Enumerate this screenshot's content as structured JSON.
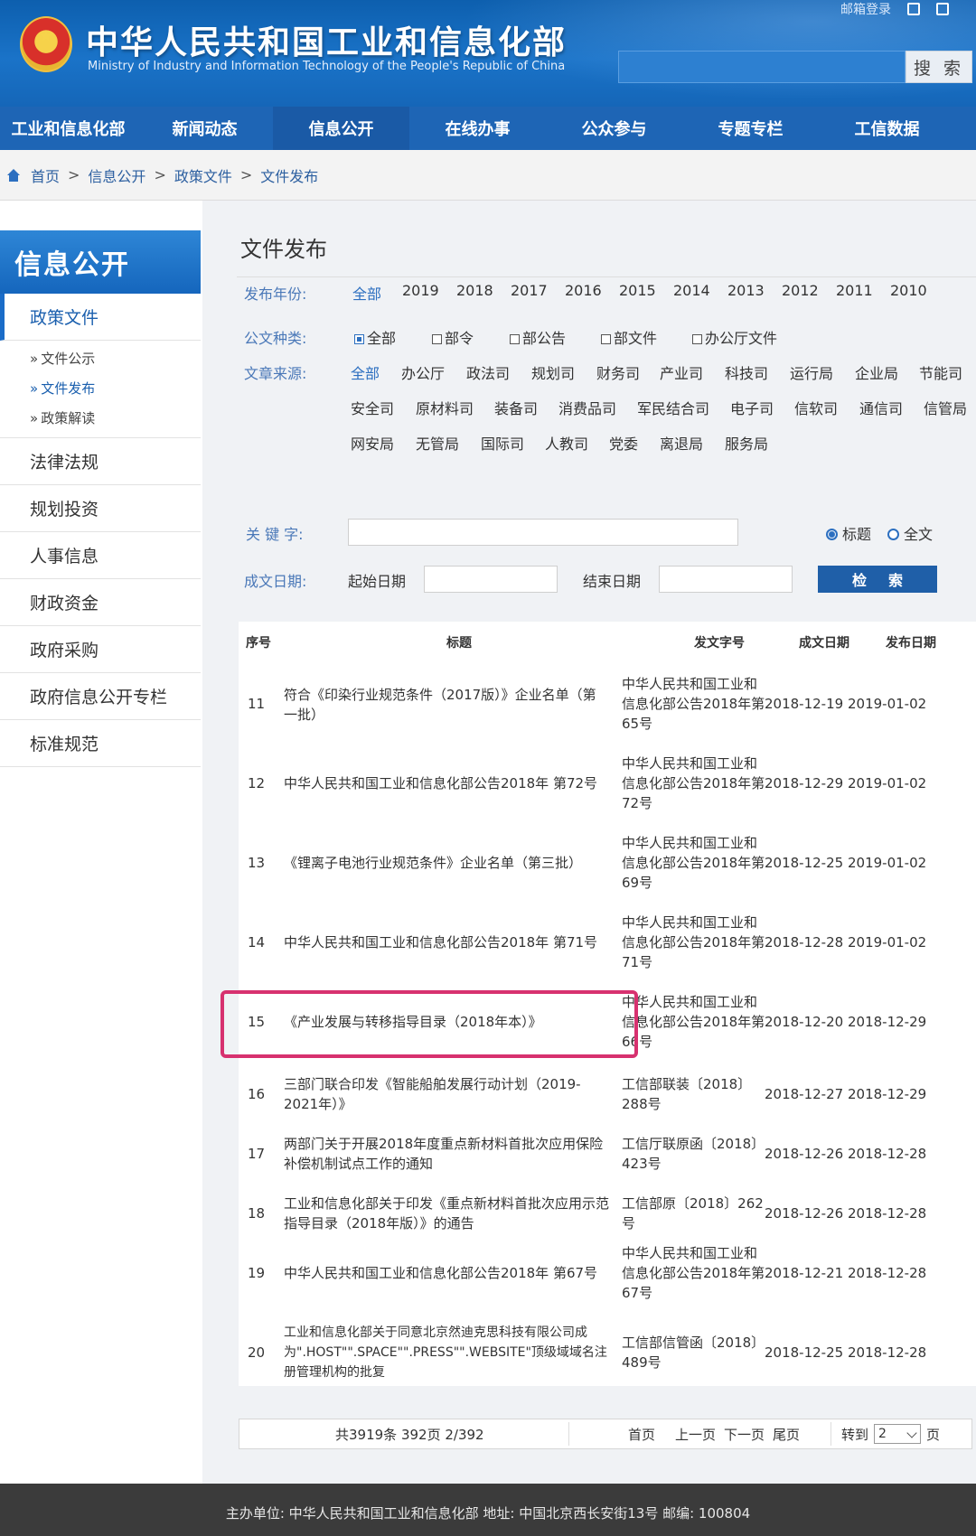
{
  "header": {
    "title": "中华人民共和国工业和信息化部",
    "subtitle": "Ministry of Industry and Information Technology of the People's Republic of China",
    "top_link": "邮箱登录",
    "search_button": "搜 索"
  },
  "nav": [
    "工业和信息化部",
    "新闻动态",
    "信息公开",
    "在线办事",
    "公众参与",
    "专题专栏",
    "工信数据"
  ],
  "breadcrumb": [
    "首页",
    "信息公开",
    "政策文件",
    "文件发布"
  ],
  "sidebar": {
    "heading": "信息公开",
    "active_item": "政策文件",
    "sub_items": [
      "文件公示",
      "文件发布",
      "政策解读"
    ],
    "items": [
      "法律法规",
      "规划投资",
      "人事信息",
      "财政资金",
      "政府采购",
      "政府信息公开专栏",
      "标准规范"
    ]
  },
  "main": {
    "title": "文件发布",
    "year_label": "发布年份:",
    "years": [
      "全部",
      "2019",
      "2018",
      "2017",
      "2016",
      "2015",
      "2014",
      "2013",
      "2012",
      "2011",
      "2010"
    ],
    "type_label": "公文种类:",
    "types": [
      "全部",
      "部令",
      "部公告",
      "部文件",
      "办公厅文件"
    ],
    "source_label": "文章来源:",
    "sources": [
      "全部",
      "办公厅",
      "政法司",
      "规划司",
      "财务司",
      "产业司",
      "科技司",
      "运行局",
      "企业局",
      "节能司",
      "安全司",
      "原材料司",
      "装备司",
      "消费品司",
      "军民结合司",
      "电子司",
      "信软司",
      "通信司",
      "信管局",
      "网安局",
      "无管局",
      "国际司",
      "人教司",
      "党委",
      "离退局",
      "服务局"
    ],
    "keyword_label": "关 键 字:",
    "radio_title": "标题",
    "radio_full": "全文",
    "date_label": "成文日期:",
    "start_label": "起始日期",
    "end_label": "结束日期",
    "search_label": "检索"
  },
  "table": {
    "headers": [
      "序号",
      "标题",
      "发文字号",
      "成文日期",
      "发布日期"
    ],
    "rows": [
      {
        "num": "11",
        "title": "符合《印染行业规范条件（2017版）》企业名单（第一批）",
        "doc": "中华人民共和国工业和信息化部公告2018年第65号",
        "written": "2018-12-19",
        "published": "2019-01-02"
      },
      {
        "num": "12",
        "title": "中华人民共和国工业和信息化部公告2018年 第72号",
        "doc": "中华人民共和国工业和信息化部公告2018年第72号",
        "written": "2018-12-29",
        "published": "2019-01-02"
      },
      {
        "num": "13",
        "title": "《锂离子电池行业规范条件》企业名单（第三批）",
        "doc": "中华人民共和国工业和信息化部公告2018年第69号",
        "written": "2018-12-25",
        "published": "2019-01-02"
      },
      {
        "num": "14",
        "title": "中华人民共和国工业和信息化部公告2018年 第71号",
        "doc": "中华人民共和国工业和信息化部公告2018年第71号",
        "written": "2018-12-28",
        "published": "2019-01-02"
      },
      {
        "num": "15",
        "title": "《产业发展与转移指导目录（2018年本）》",
        "doc": "中华人民共和国工业和信息化部公告2018年第66号",
        "written": "2018-12-20",
        "published": "2018-12-29"
      },
      {
        "num": "16",
        "title": "三部门联合印发《智能船舶发展行动计划（2019-2021年）》",
        "doc": "工信部联装〔2018〕288号",
        "written": "2018-12-27",
        "published": "2018-12-29"
      },
      {
        "num": "17",
        "title": "两部门关于开展2018年度重点新材料首批次应用保险补偿机制试点工作的通知",
        "doc": "工信厅联原函〔2018〕423号",
        "written": "2018-12-26",
        "published": "2018-12-28"
      },
      {
        "num": "18",
        "title": "工业和信息化部关于印发《重点新材料首批次应用示范指导目录（2018年版）》的通告",
        "doc": "工信部原〔2018〕262号",
        "written": "2018-12-26",
        "published": "2018-12-28"
      },
      {
        "num": "19",
        "title": "中华人民共和国工业和信息化部公告2018年 第67号",
        "doc": "中华人民共和国工业和信息化部公告2018年第67号",
        "written": "2018-12-21",
        "published": "2018-12-28"
      },
      {
        "num": "20",
        "title": "工业和信息化部关于同意北京然迪克思科技有限公司成为\".HOST\"\".SPACE\"\".PRESS\"\".WEBSITE\"顶级域域名注册管理机构的批复",
        "doc": "工信部信管函〔2018〕489号",
        "written": "2018-12-25",
        "published": "2018-12-28"
      }
    ]
  },
  "pager": {
    "summary": "共3919条 392页 2/392",
    "first": "首页",
    "prev": "上一页",
    "next": "下一页",
    "last": "尾页",
    "goto": "转到",
    "page_value": "2",
    "page_unit": "页"
  },
  "footer": {
    "text": "主办单位: 中华人民共和国工业和信息化部 地址: 中国北京西长安街13号 邮编: 100804"
  }
}
